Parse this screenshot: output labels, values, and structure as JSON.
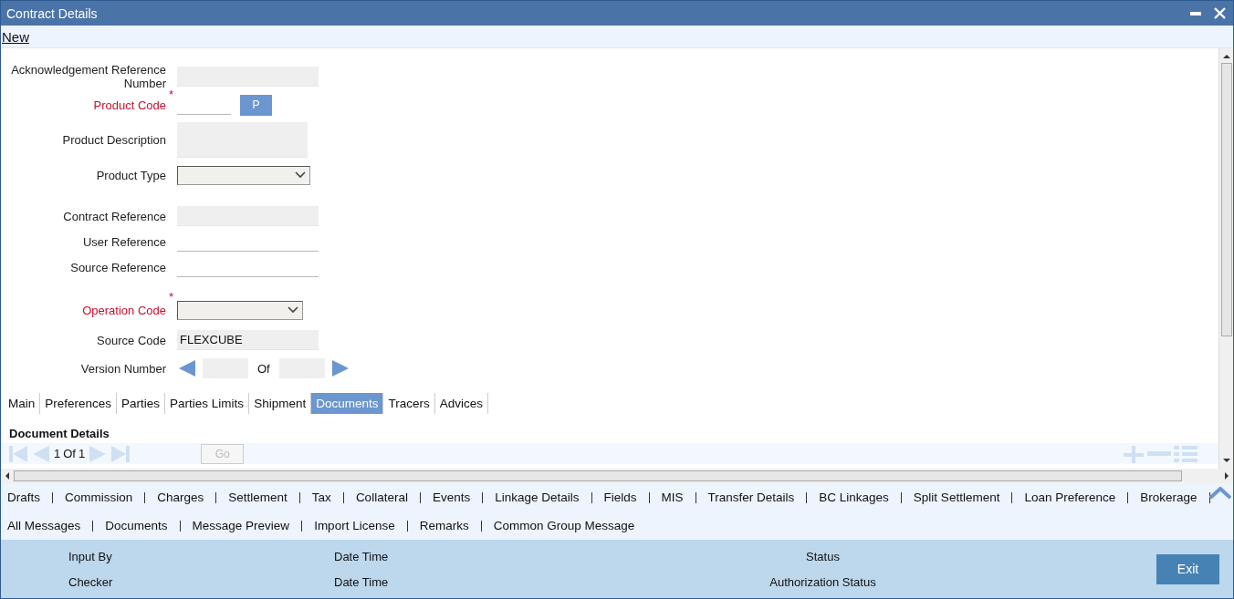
{
  "window": {
    "title": "Contract Details"
  },
  "toolbar": {
    "new_link": "New"
  },
  "fields": [
    {
      "kind": "text",
      "label": "Acknowledgement Reference Number",
      "readonly": true
    },
    {
      "kind": "lookup",
      "label": "Product Code",
      "required_mark": "*",
      "readonly": false,
      "button": "P"
    },
    {
      "kind": "textarea",
      "label": "Product Description",
      "readonly": true
    },
    {
      "kind": "select",
      "label": "Product Type"
    },
    {
      "kind": "text",
      "label": "Contract Reference",
      "readonly": true
    },
    {
      "kind": "text",
      "label": "User Reference",
      "readonly": false
    },
    {
      "kind": "text",
      "label": "Source Reference",
      "readonly": false
    },
    {
      "kind": "select",
      "label": "Operation Code",
      "required_mark": "*"
    },
    {
      "kind": "text",
      "label": "Source Code",
      "readonly": true,
      "value": "FLEXCUBE"
    },
    {
      "kind": "version",
      "label": "Version Number",
      "separator": "Of"
    }
  ],
  "tabs": [
    {
      "label": "Main",
      "selected": false
    },
    {
      "label": "Preferences",
      "selected": false
    },
    {
      "label": "Parties",
      "selected": false
    },
    {
      "label": "Parties Limits",
      "selected": false
    },
    {
      "label": "Shipment",
      "selected": false
    },
    {
      "label": "Documents",
      "selected": true
    },
    {
      "label": "Tracers",
      "selected": false
    },
    {
      "label": "Advices",
      "selected": false
    }
  ],
  "section": {
    "title": "Document Details",
    "pager": {
      "page": "1",
      "of": "Of",
      "total": "1",
      "go_button": "Go",
      "go_disabled": true
    }
  },
  "links_row_1": [
    "Drafts",
    "Commission",
    "Charges",
    "Settlement",
    "Tax",
    "Collateral",
    "Events",
    "Linkage Details",
    "Fields",
    "MIS",
    "Transfer Details",
    "BC Linkages",
    "Split Settlement",
    "Loan Preference",
    "Brokerage"
  ],
  "links_row_2": [
    "All Messages",
    "Documents",
    "Message Preview",
    "Import License",
    "Remarks",
    "Common Group Message"
  ],
  "footer": {
    "columns": [
      [
        "Input By",
        "Checker"
      ],
      [
        "Date Time",
        "Date Time"
      ],
      [
        "Status",
        "Authorization Status"
      ]
    ],
    "exit_button": "Exit"
  }
}
